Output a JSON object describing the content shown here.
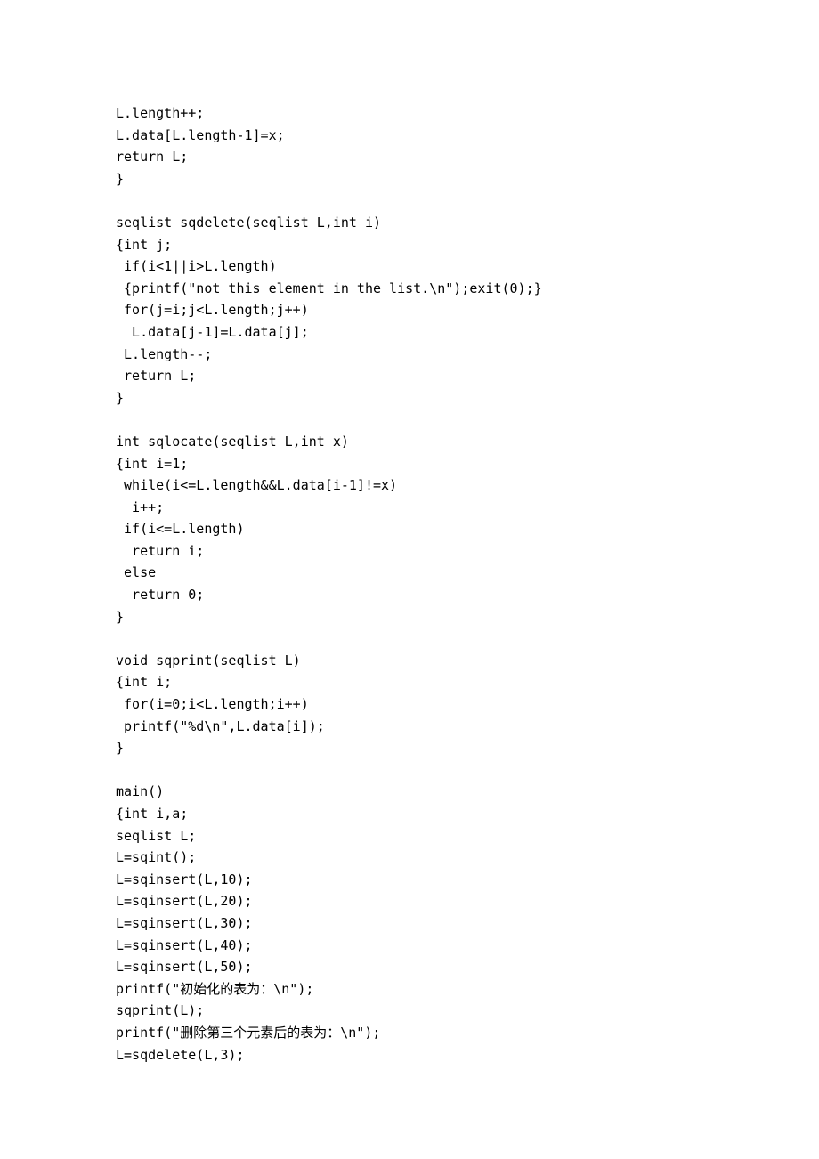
{
  "code": {
    "lines": [
      "L.length++;",
      "L.data[L.length-1]=x;",
      "return L;",
      "}",
      "",
      "seqlist sqdelete(seqlist L,int i)",
      "{int j;",
      " if(i<1||i>L.length)",
      " {printf(\"not this element in the list.\\n\");exit(0);}",
      " for(j=i;j<L.length;j++)",
      "  L.data[j-1]=L.data[j];",
      " L.length--;",
      " return L;",
      "}",
      "",
      "int sqlocate(seqlist L,int x)",
      "{int i=1;",
      " while(i<=L.length&&L.data[i-1]!=x)",
      "  i++;",
      " if(i<=L.length)",
      "  return i;",
      " else",
      "  return 0;",
      "}",
      "",
      "void sqprint(seqlist L)",
      "{int i;",
      " for(i=0;i<L.length;i++)",
      " printf(\"%d\\n\",L.data[i]);",
      "}",
      "",
      "main()",
      "{int i,a;",
      "seqlist L;",
      "L=sqint();",
      "L=sqinsert(L,10);",
      "L=sqinsert(L,20);",
      "L=sqinsert(L,30);",
      "L=sqinsert(L,40);",
      "L=sqinsert(L,50);",
      "printf(\"初始化的表为：\\n\");",
      "sqprint(L);",
      "printf(\"删除第三个元素后的表为：\\n\");",
      "L=sqdelete(L,3);"
    ]
  }
}
